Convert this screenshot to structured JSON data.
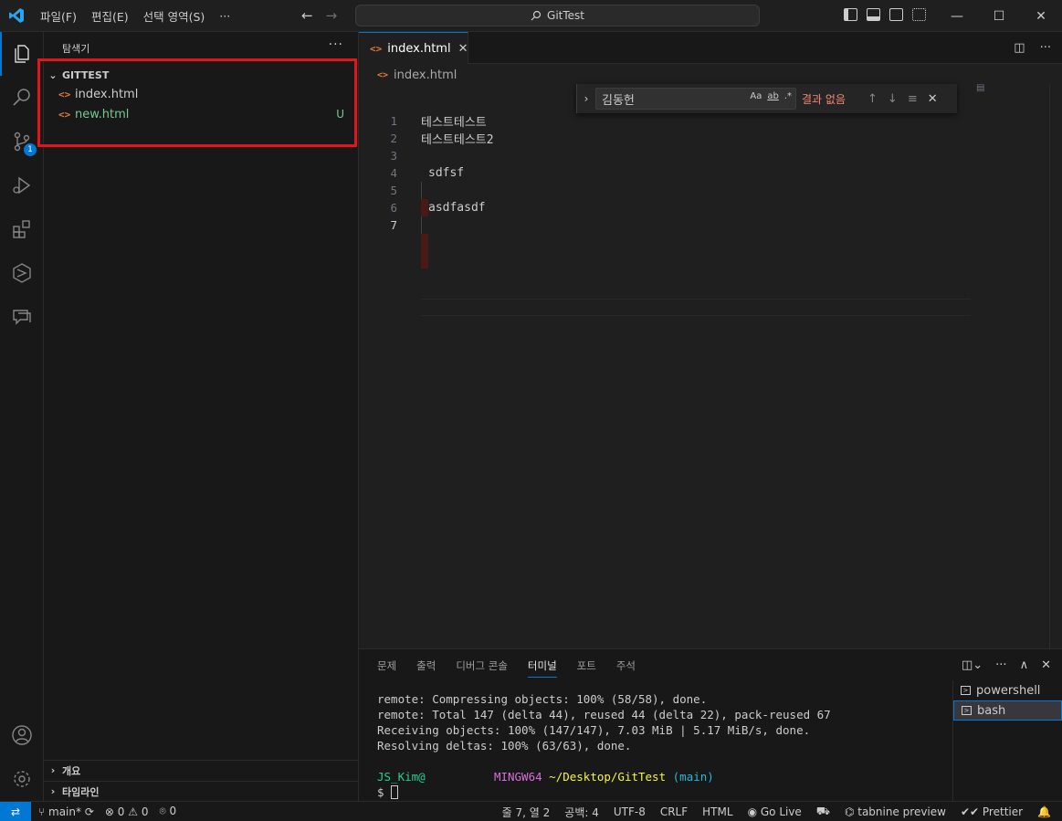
{
  "titlebar": {
    "menu": [
      "파일(F)",
      "편집(E)",
      "선택 영역(S)",
      "···"
    ],
    "search_text": "GitTest"
  },
  "activitybar": {
    "items": [
      "explorer-icon",
      "search-icon",
      "source-control-icon",
      "run-debug-icon",
      "extensions-icon",
      "remote-explorer-icon",
      "chat-icon"
    ],
    "scm_badge": "1"
  },
  "sidebar": {
    "title": "탐색기",
    "more": "···",
    "folder": "GITTEST",
    "files": [
      {
        "name": "index.html",
        "status": ""
      },
      {
        "name": "new.html",
        "status": "U"
      }
    ],
    "outline": "개요",
    "timeline": "타임라인"
  },
  "editor": {
    "tab_label": "index.html",
    "breadcrumb": "index.html",
    "find": {
      "query": "김동헌",
      "opt_case": "Aa",
      "opt_word": "ab",
      "opt_regex": ".*",
      "result": "결과 없음"
    },
    "lines": [
      {
        "num": "1",
        "text": "테스트테스트"
      },
      {
        "num": "2",
        "text": "테스트테스트2"
      },
      {
        "num": "3",
        "text": ""
      },
      {
        "num": "4",
        "text": "sdfsf"
      },
      {
        "num": "5",
        "text": ""
      },
      {
        "num": "6",
        "text": "asdfasdf"
      },
      {
        "num": "7",
        "text": ""
      }
    ]
  },
  "panel": {
    "tabs": [
      "문제",
      "출력",
      "디버그 콘솔",
      "터미널",
      "포트",
      "주석"
    ],
    "active_tab": "터미널",
    "terminal_lines": [
      "remote: Compressing objects: 100% (58/58), done.",
      "remote: Total 147 (delta 44), reused 44 (delta 22), pack-reused 67",
      "Receiving objects: 100% (147/147), 7.03 MiB | 5.17 MiB/s, done.",
      "Resolving deltas: 100% (63/63), done."
    ],
    "prompt_user": "JS_Kim@",
    "prompt_host": "MINGW64",
    "prompt_path": "~/Desktop/GitTest",
    "prompt_branch": "(main)",
    "prompt_symbol": "$",
    "terminals": [
      "powershell",
      "bash"
    ]
  },
  "statusbar": {
    "branch": "main*",
    "errors": "0",
    "warnings": "0",
    "ports": "0",
    "cursor": "줄 7, 열 2",
    "spaces": "공백: 4",
    "encoding": "UTF-8",
    "eol": "CRLF",
    "language": "HTML",
    "golive": "Go Live",
    "tabnine": "tabnine preview",
    "prettier": "Prettier"
  },
  "colors": {
    "accent": "#0078d4",
    "highlight_box": "#e3151a",
    "untracked": "#73c991"
  }
}
